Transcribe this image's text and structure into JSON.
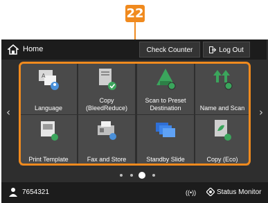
{
  "callout": {
    "number": "22"
  },
  "topbar": {
    "home_label": "Home",
    "check_counter": "Check Counter",
    "logout": "Log Out"
  },
  "tiles": [
    {
      "label1": "Language",
      "label2": "",
      "icon": "language-icon"
    },
    {
      "label1": "Copy",
      "label2": "(BleedReduce)",
      "icon": "copy-icon"
    },
    {
      "label1": "Scan to Preset",
      "label2": "Destination",
      "icon": "scan-preset-icon"
    },
    {
      "label1": "Name and Scan",
      "label2": "",
      "icon": "name-scan-icon"
    },
    {
      "label1": "Print Template",
      "label2": "",
      "icon": "print-template-icon"
    },
    {
      "label1": "Fax and Store",
      "label2": "",
      "icon": "fax-store-icon"
    },
    {
      "label1": "Standby Slide",
      "label2": "",
      "icon": "standby-slide-icon"
    },
    {
      "label1": "Copy (Eco)",
      "label2": "",
      "icon": "copy-eco-icon"
    }
  ],
  "pagination": {
    "pages": 4,
    "current": 3
  },
  "statusbar": {
    "user_id": "7654321",
    "wifi": "((•))",
    "status_monitor": "Status Monitor"
  },
  "colors": {
    "accent": "#f08a1e",
    "panel": "#2e2e2e",
    "tile": "#4a4a4a",
    "bar": "#1c1c1c",
    "green": "#3ba55c"
  }
}
